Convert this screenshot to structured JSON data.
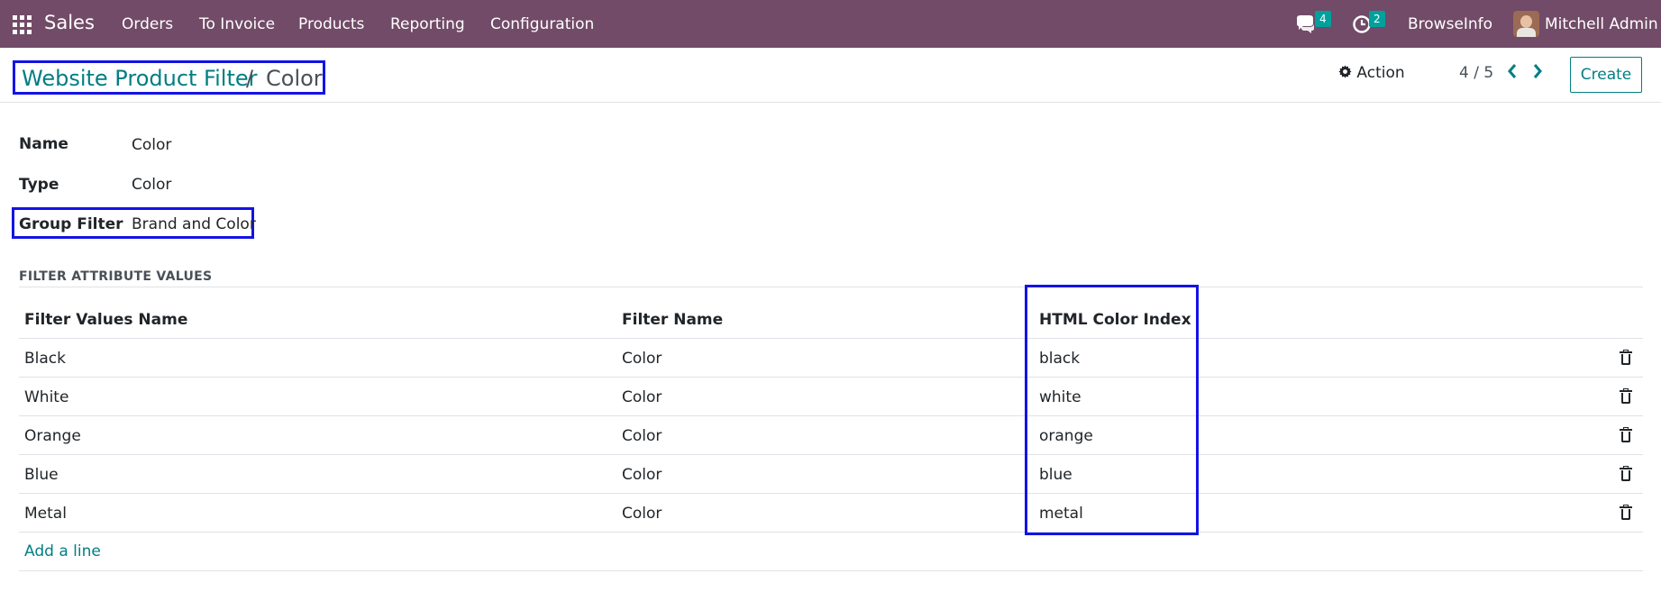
{
  "navbar": {
    "app_name": "Sales",
    "menu": [
      "Orders",
      "To Invoice",
      "Products",
      "Reporting",
      "Configuration"
    ],
    "messages_count": "4",
    "activities_count": "2",
    "company": "BrowseInfo",
    "user": "Mitchell Admin"
  },
  "breadcrumb": {
    "parent": "Website Product Filter",
    "separator": "/",
    "current": "Color"
  },
  "control": {
    "action_label": "Action",
    "pager": "4 / 5",
    "create_label": "Create"
  },
  "form": {
    "name_label": "Name",
    "name_value": "Color",
    "type_label": "Type",
    "type_value": "Color",
    "group_filter_label": "Group Filter",
    "group_filter_value": "Brand and Color"
  },
  "section_title": "FILTER ATTRIBUTE VALUES",
  "table": {
    "headers": [
      "Filter Values Name",
      "Filter Name",
      "HTML Color Index"
    ],
    "rows": [
      {
        "name": "Black",
        "filter": "Color",
        "color_index": "black"
      },
      {
        "name": "White",
        "filter": "Color",
        "color_index": "white"
      },
      {
        "name": "Orange",
        "filter": "Color",
        "color_index": "orange"
      },
      {
        "name": "Blue",
        "filter": "Color",
        "color_index": "blue"
      },
      {
        "name": "Metal",
        "filter": "Color",
        "color_index": "metal"
      }
    ],
    "add_line": "Add a line"
  },
  "icons": {
    "apps": "apps-grid-icon",
    "messages": "chat-icon",
    "activities": "clock-icon",
    "action": "gear-icon",
    "prev": "chevron-left-icon",
    "next": "chevron-right-icon",
    "delete": "trash-icon"
  },
  "colors": {
    "navbar": "#714b67",
    "accent": "#017e84",
    "badge": "#00a09d",
    "highlight_box": "#1313e6"
  }
}
